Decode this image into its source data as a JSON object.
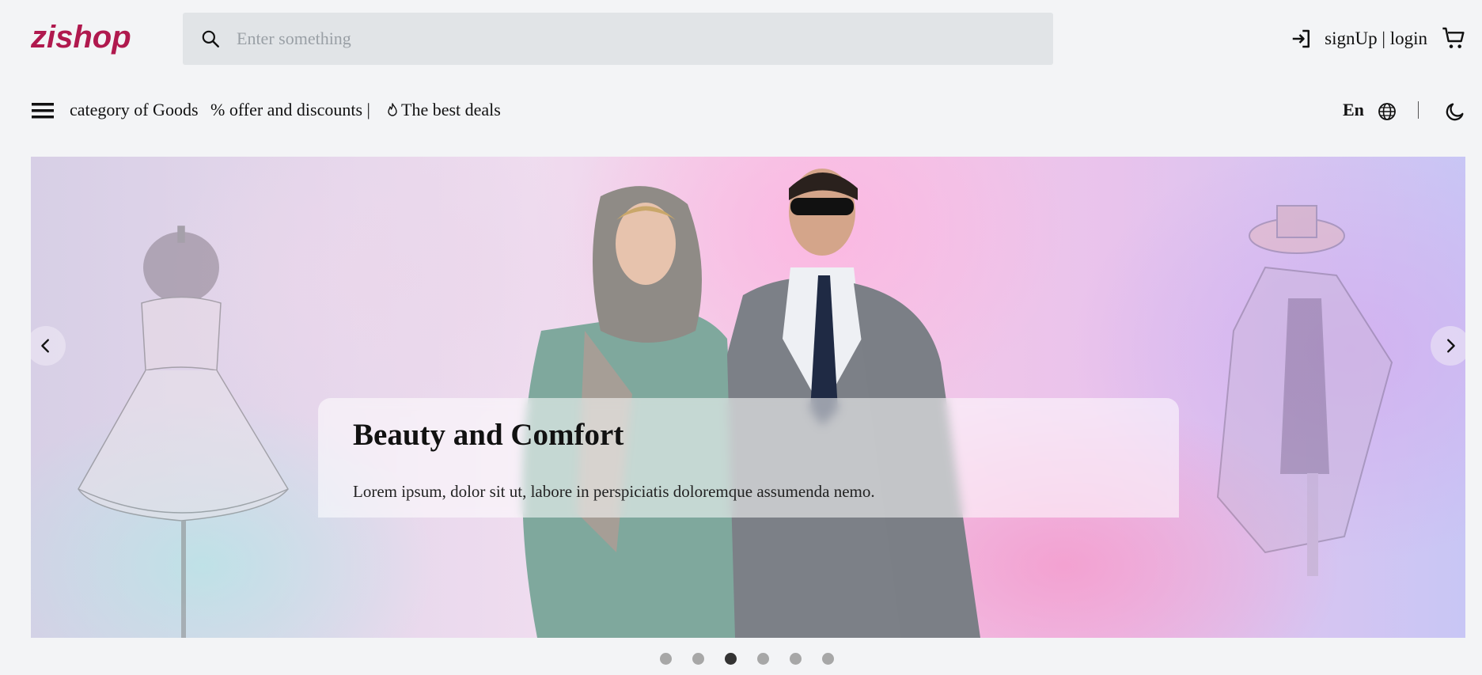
{
  "header": {
    "logo_text": "zishop",
    "search_placeholder": "Enter something",
    "search_value": "",
    "login_label": "signUp | login"
  },
  "nav": {
    "category_label": "category of Goods",
    "offer_label": "% offer and discounts |",
    "best_label": "The best deals",
    "language": "En"
  },
  "banner": {
    "title": "Beauty and Comfort",
    "text": "Lorem ipsum, dolor sit ut, labore in perspiciatis doloremque assumenda nemo.",
    "slides_count": 6,
    "active_slide": 3
  },
  "colors": {
    "brand": "#b0194e",
    "background": "#f3f4f6",
    "search_bg": "#e1e4e7",
    "dot_active": "#333333",
    "dot_inactive": "#a7a7a7"
  },
  "icons": {
    "search": "search-icon",
    "login": "login-icon",
    "cart": "cart-icon",
    "menu": "menu-icon",
    "flame": "flame-icon",
    "globe": "globe-icon",
    "theme": "moon-icon",
    "prev": "chevron-left-icon",
    "next": "chevron-right-icon"
  }
}
